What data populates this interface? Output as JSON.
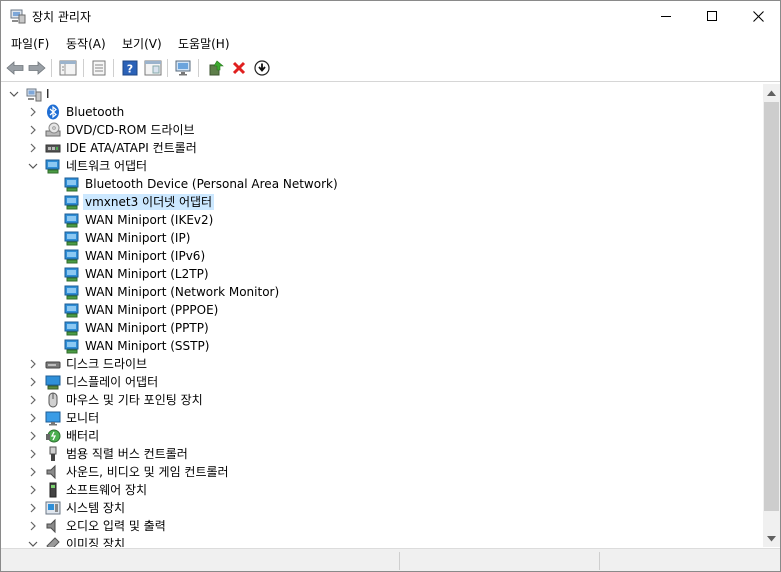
{
  "window": {
    "title": "장치 관리자"
  },
  "menu": {
    "items": [
      "파일(F)",
      "동작(A)",
      "보기(V)",
      "도움말(H)"
    ]
  },
  "toolbar": {
    "buttons": [
      "back-icon",
      "forward-icon",
      "properties-view-icon",
      "list-icon",
      "help-icon",
      "view-icon",
      "monitor-scan-icon",
      "update-driver-icon",
      "uninstall-icon",
      "download-icon"
    ]
  },
  "tree": {
    "root": {
      "label": "I"
    },
    "categories": [
      {
        "label": "Bluetooth",
        "expanded": false,
        "icon": "bluetooth-icon"
      },
      {
        "label": "DVD/CD-ROM 드라이브",
        "expanded": false,
        "icon": "dvd-drive-icon"
      },
      {
        "label": "IDE ATA/ATAPI 컨트롤러",
        "expanded": false,
        "icon": "ide-controller-icon"
      },
      {
        "label": "네트워크 어댑터",
        "expanded": true,
        "icon": "network-adapter-icon",
        "children": [
          {
            "label": "Bluetooth Device (Personal Area Network)",
            "selected": false
          },
          {
            "label": "vmxnet3 이더넷 어댑터",
            "selected": true
          },
          {
            "label": "WAN Miniport (IKEv2)",
            "selected": false
          },
          {
            "label": "WAN Miniport (IP)",
            "selected": false
          },
          {
            "label": "WAN Miniport (IPv6)",
            "selected": false
          },
          {
            "label": "WAN Miniport (L2TP)",
            "selected": false
          },
          {
            "label": "WAN Miniport (Network Monitor)",
            "selected": false
          },
          {
            "label": "WAN Miniport (PPPOE)",
            "selected": false
          },
          {
            "label": "WAN Miniport (PPTP)",
            "selected": false
          },
          {
            "label": "WAN Miniport (SSTP)",
            "selected": false
          }
        ]
      },
      {
        "label": "디스크 드라이브",
        "expanded": false,
        "icon": "disk-drive-icon"
      },
      {
        "label": "디스플레이 어댑터",
        "expanded": false,
        "icon": "display-adapter-icon"
      },
      {
        "label": "마우스 및 기타 포인팅 장치",
        "expanded": false,
        "icon": "mouse-icon"
      },
      {
        "label": "모니터",
        "expanded": false,
        "icon": "monitor-icon"
      },
      {
        "label": "배터리",
        "expanded": false,
        "icon": "battery-icon"
      },
      {
        "label": "범용 직렬 버스 컨트롤러",
        "expanded": false,
        "icon": "usb-icon"
      },
      {
        "label": "사운드, 비디오 및 게임 컨트롤러",
        "expanded": false,
        "icon": "speaker-icon"
      },
      {
        "label": "소프트웨어 장치",
        "expanded": false,
        "icon": "software-device-icon"
      },
      {
        "label": "시스템 장치",
        "expanded": false,
        "icon": "system-device-icon"
      },
      {
        "label": "오디오 입력 및 출력",
        "expanded": false,
        "icon": "audio-icon"
      },
      {
        "label": "이미징 장치",
        "expanded": false,
        "icon": "camera-icon"
      }
    ]
  },
  "colors": {
    "selection": "#cce8ff",
    "network_blue": "#2f8fd8",
    "uninstall_red": "#e0201f"
  }
}
